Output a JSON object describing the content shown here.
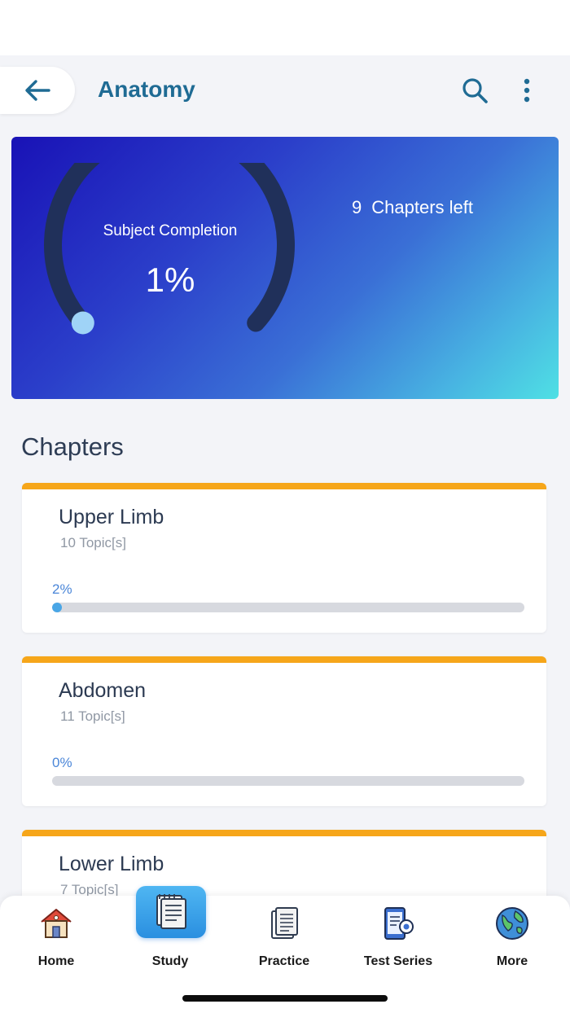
{
  "header": {
    "title": "Anatomy",
    "back_icon": "arrow-left-icon",
    "search_icon": "search-icon",
    "menu_icon": "more-vertical-icon"
  },
  "hero": {
    "gauge_label": "Subject Completion",
    "completion": "1%",
    "completion_value": 0.01,
    "chapters_left_count": "9",
    "chapters_left_label": "Chapters left"
  },
  "chapters_section": {
    "title": "Chapters",
    "items": [
      {
        "name": "Upper Limb",
        "topics": "10 Topic[s]",
        "percent_label": "2%",
        "progress": 0.02
      },
      {
        "name": "Abdomen",
        "topics": "11 Topic[s]",
        "percent_label": "0%",
        "progress": 0.0
      },
      {
        "name": "Lower Limb",
        "topics": "7 Topic[s]",
        "percent_label": "",
        "progress": 0.0
      }
    ]
  },
  "bottom_nav": {
    "items": [
      {
        "label": "Home",
        "icon": "home-icon",
        "active": false
      },
      {
        "label": "Study",
        "icon": "notebook-icon",
        "active": true
      },
      {
        "label": "Practice",
        "icon": "document-icon",
        "active": false
      },
      {
        "label": "Test Series",
        "icon": "phone-test-icon",
        "active": false
      },
      {
        "label": "More",
        "icon": "globe-icon",
        "active": false
      }
    ]
  },
  "colors": {
    "accent": "#1f6b94",
    "card_top_border": "#f6a61a",
    "progress_fill": "#49a6e6",
    "gauge_track": "#20305a",
    "gauge_knob": "#9fd3f7"
  }
}
